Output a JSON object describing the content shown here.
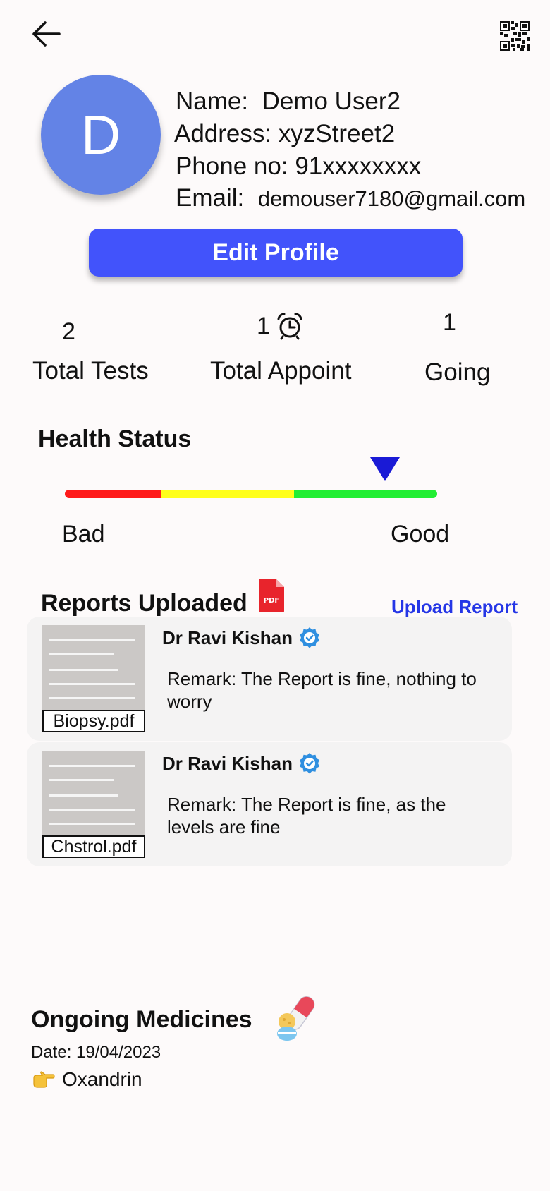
{
  "header": {
    "back_icon": "arrow-left-icon",
    "qr_icon": "qr-code-icon"
  },
  "profile": {
    "avatar_letter": "D",
    "avatar_color": "#6383e6",
    "name_label": "Name:",
    "name_value": "Demo User2",
    "address_label": "Address:",
    "address_value": "xyzStreet2",
    "phone_label": "Phone no:",
    "phone_value": "91xxxxxxxx",
    "email_label": "Email:",
    "email_value": "demouser7180@gmail.com",
    "edit_button_label": "Edit Profile",
    "edit_button_color": "#4253fb"
  },
  "stats": [
    {
      "value": "2",
      "label": "Total Tests"
    },
    {
      "value": "1",
      "label": "Total Appoint",
      "icon": "alarm-clock-icon"
    },
    {
      "value": "1",
      "label": "Going"
    }
  ],
  "health": {
    "title": "Health Status",
    "low_label": "Bad",
    "high_label": "Good",
    "level": 0.86,
    "segments": [
      {
        "color": "#ff1a1a",
        "fraction": 0.26
      },
      {
        "color": "#ffff1a",
        "fraction": 0.355
      },
      {
        "color": "#22ee33",
        "fraction": 0.385
      }
    ],
    "marker_color": "#1a1ad6"
  },
  "reports": {
    "title": "Reports Uploaded",
    "title_icon": "pdf-file-icon",
    "upload_link": "Upload Report",
    "items": [
      {
        "file": "Biopsy.pdf",
        "doctor": "Dr Ravi Kishan",
        "verified_icon": "verified-badge-icon",
        "remark": "Remark: The Report is fine, nothing to worry"
      },
      {
        "file": "Chstrol.pdf",
        "doctor": "Dr Ravi Kishan",
        "verified_icon": "verified-badge-icon",
        "remark": "Remark: The Report is fine, as the levels are fine"
      }
    ]
  },
  "medicines": {
    "title": "Ongoing Medicines",
    "title_icon": "pills-icon",
    "date": "Date: 19/04/2023",
    "items": [
      {
        "icon": "pointing-hand-icon",
        "name": "Oxandrin"
      }
    ]
  }
}
